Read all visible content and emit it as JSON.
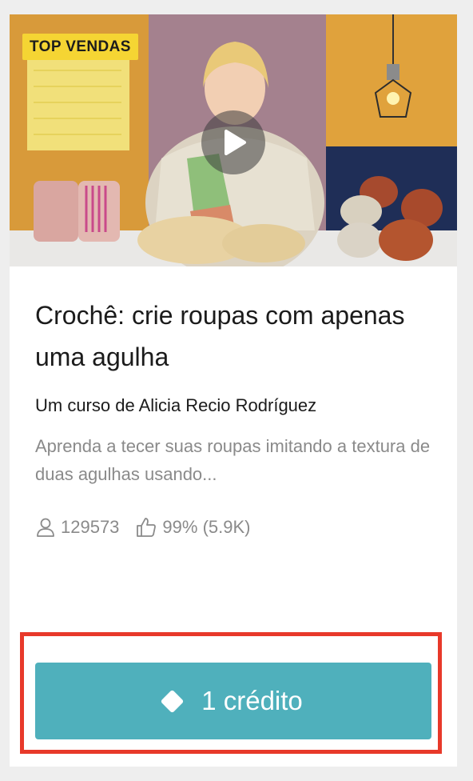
{
  "course_card": {
    "badge": "TOP VENDAS",
    "title": "Crochê: crie roupas com apenas uma agulha",
    "author": "Um curso de Alicia Recio Rodríguez",
    "description": "Aprenda a tecer suas roupas imitando a textura de duas agulhas usando...",
    "stats": {
      "students": "129573",
      "rating": "99% (5.9K)"
    },
    "cta": {
      "label": "1 crédito"
    }
  },
  "icons": {
    "play": "play-icon",
    "students": "user-icon",
    "rating": "thumbs-up-icon",
    "credit": "diamond-icon"
  },
  "colors": {
    "badge_background": "#f5d533",
    "cta_background": "#4fb0bc",
    "highlight_border": "#e8392a",
    "muted_text": "#8a8a8a"
  }
}
